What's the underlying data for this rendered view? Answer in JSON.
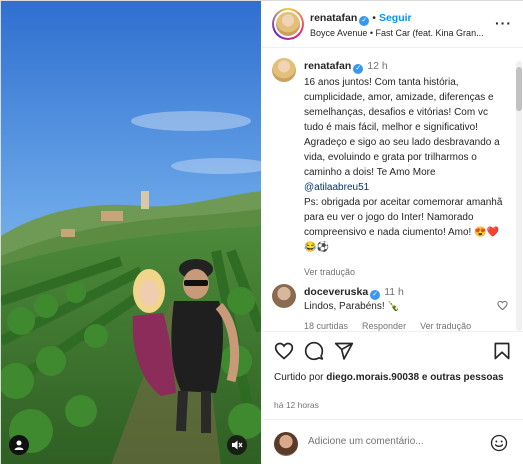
{
  "post": {
    "username": "renatafan",
    "follow_label": "Seguir",
    "separator": "•",
    "audio": "Boyce Avenue • Fast Car (feat. Kina Gran...",
    "more_label": "···"
  },
  "caption": {
    "username": "renatafan",
    "time": "12 h",
    "text_before_mention": "16 anos juntos! Com tanta história, cumplicidade, amor, amizade, diferenças e semelhanças, desafios e vitórias! Com vc tudo é mais fácil, melhor e significativo! Agradeço e sigo ao seu lado desbravando a vida, evoluindo e grata por trilharmos o caminho a dois! Te Amo More\n",
    "mention": "@atilaabreu51",
    "text_after_mention": "\nPs: obrigada por aceitar comemorar amanhã para eu ver o jogo do Inter! Namorado compreensivo e nada ciumento! Amo! 😍❤️😂⚽",
    "translate_label": "Ver tradução"
  },
  "comment": {
    "username": "doceveruska",
    "time": "11 h",
    "text": "Lindos, Parabéns! 🍾",
    "likes": "18 curtidas",
    "reply_label": "Responder",
    "translate_label": "Ver tradução"
  },
  "likes": {
    "prefix": "Curtido por ",
    "user": "diego.morais.90038",
    "suffix": " e outras pessoas"
  },
  "posted_time": "há 12 horas",
  "add_comment": {
    "placeholder": "Adicione um comentário..."
  },
  "colors": {
    "accent": "#0095f6",
    "verified": "#3897f0",
    "muted": "#737373"
  },
  "icons": [
    "heart-icon",
    "comment-icon",
    "share-icon",
    "save-icon",
    "emoji-icon",
    "mute-icon",
    "verified-icon",
    "more-icon"
  ]
}
